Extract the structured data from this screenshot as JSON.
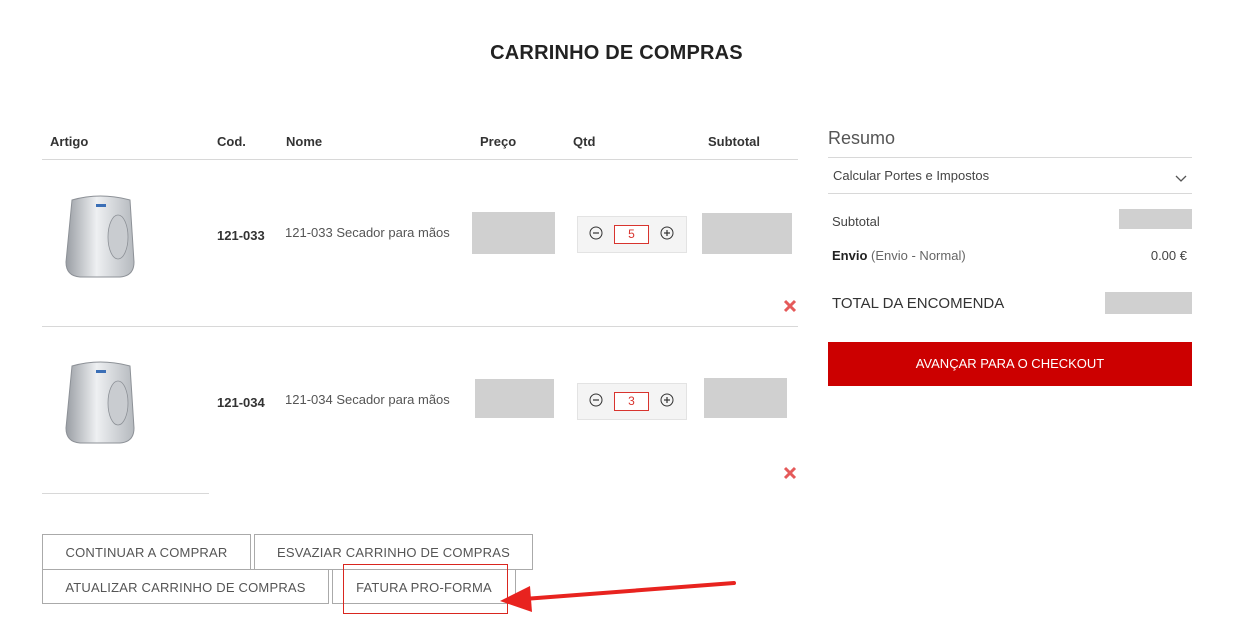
{
  "page": {
    "title": "CARRINHO DE COMPRAS"
  },
  "table": {
    "headers": [
      "Artigo",
      "Cod.",
      "Nome",
      "Preço",
      "Qtd",
      "Subtotal"
    ]
  },
  "items": [
    {
      "code": "121-033",
      "name": "121-033 Secador para mãos",
      "qty": "5"
    },
    {
      "code": "121-034",
      "name": "121-034 Secador para mãos",
      "qty": "3"
    }
  ],
  "icons": {
    "qty_minus": "minus-circle-icon",
    "qty_plus": "plus-circle-icon",
    "remove": "remove-x-icon",
    "chevron": "chevron-down-icon",
    "arrow": "red-arrow-annotation"
  },
  "actions": {
    "continue": "CONTINUAR A COMPRAR",
    "empty": "ESVAZIAR CARRINHO DE COMPRAS",
    "update": "ATUALIZAR CARRINHO DE COMPRAS",
    "proforma": "FATURA PRO-FORMA"
  },
  "summary": {
    "title": "Resumo",
    "shipping_toggle": "Calcular Portes e Impostos",
    "subtotal_label": "Subtotal",
    "shipping_label": "Envio",
    "shipping_method": "(Envio - Normal)",
    "shipping_value": "0.00 €",
    "total_label": "TOTAL DA ENCOMENDA",
    "checkout_label": "AVANÇAR PARA O CHECKOUT"
  },
  "colors": {
    "accent": "#cc0000",
    "annotation": "#e8231f",
    "redacted": "#d0d0d0"
  }
}
